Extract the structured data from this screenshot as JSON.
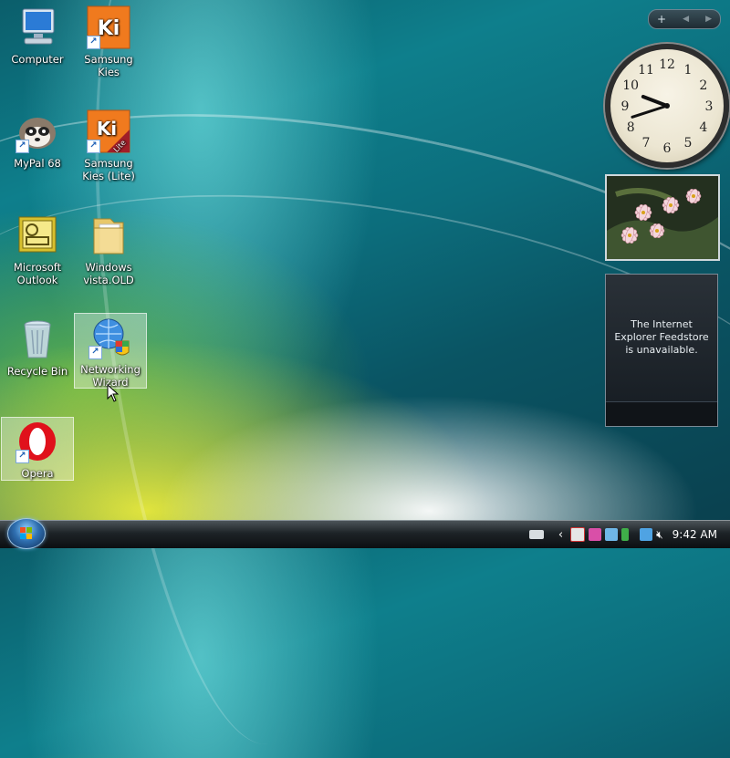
{
  "desktop": {
    "icons": [
      {
        "label": "Computer",
        "icon": "computer-icon"
      },
      {
        "label": "Samsung Kies",
        "icon": "samsung-kies-icon"
      },
      {
        "label": "MyPal 68",
        "icon": "mypal-icon"
      },
      {
        "label": "Samsung Kies (Lite)",
        "icon": "samsung-kies-lite-icon"
      },
      {
        "label": "Microsoft Outlook",
        "icon": "outlook-icon"
      },
      {
        "label": "Windows vista.OLD",
        "icon": "folder-icon"
      },
      {
        "label": "Recycle Bin",
        "icon": "recycle-bin-icon"
      },
      {
        "label": "Networking Wizard",
        "icon": "network-globe-icon"
      },
      {
        "label": "Opera",
        "icon": "opera-icon"
      }
    ]
  },
  "sidebar": {
    "nav": {
      "add": "+",
      "prev": "◀",
      "next": "▶"
    },
    "clock": {
      "numbers": [
        "12",
        "1",
        "2",
        "3",
        "4",
        "5",
        "6",
        "7",
        "8",
        "9",
        "10",
        "11"
      ],
      "hour": 9,
      "minute": 42
    },
    "feed": {
      "message": "The Internet Explorer Feedstore is unavailable."
    },
    "photo": {
      "subject": "pink-flowers"
    }
  },
  "taskbar": {
    "time": "9:42 AM",
    "tray_icons": [
      "keyboard-icon",
      "chevron-left-icon",
      "stop-icon",
      "app-icon",
      "network-icon",
      "volume-muted-icon"
    ]
  },
  "colors": {
    "accent": "#0e7f8c",
    "taskbar": "#1d2327"
  }
}
